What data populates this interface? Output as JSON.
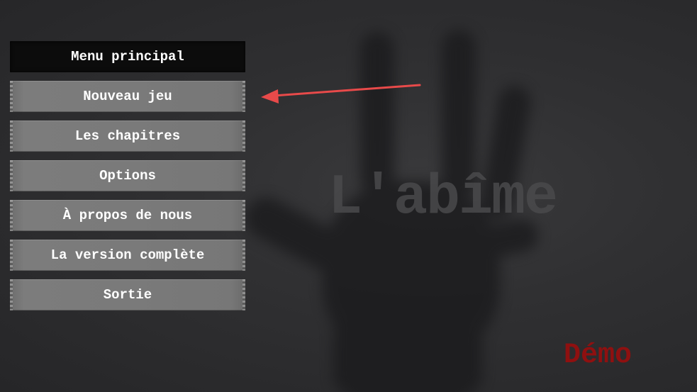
{
  "game": {
    "title": "L'abîme",
    "edition_label": "Démo"
  },
  "menu": {
    "header": "Menu principal",
    "items": [
      {
        "id": "new-game",
        "label": "Nouveau jeu"
      },
      {
        "id": "chapters",
        "label": "Les chapitres"
      },
      {
        "id": "options",
        "label": "Options"
      },
      {
        "id": "about",
        "label": "À propos de nous"
      },
      {
        "id": "full-version",
        "label": "La version complète"
      },
      {
        "id": "exit",
        "label": "Sortie"
      }
    ]
  },
  "annotation": {
    "arrow_color": "#e84a4a",
    "points_to": "new-game"
  },
  "colors": {
    "background": "#2b2b2d",
    "button": "#7a7a7a",
    "header": "#0c0c0c",
    "demo": "#8f1010"
  }
}
